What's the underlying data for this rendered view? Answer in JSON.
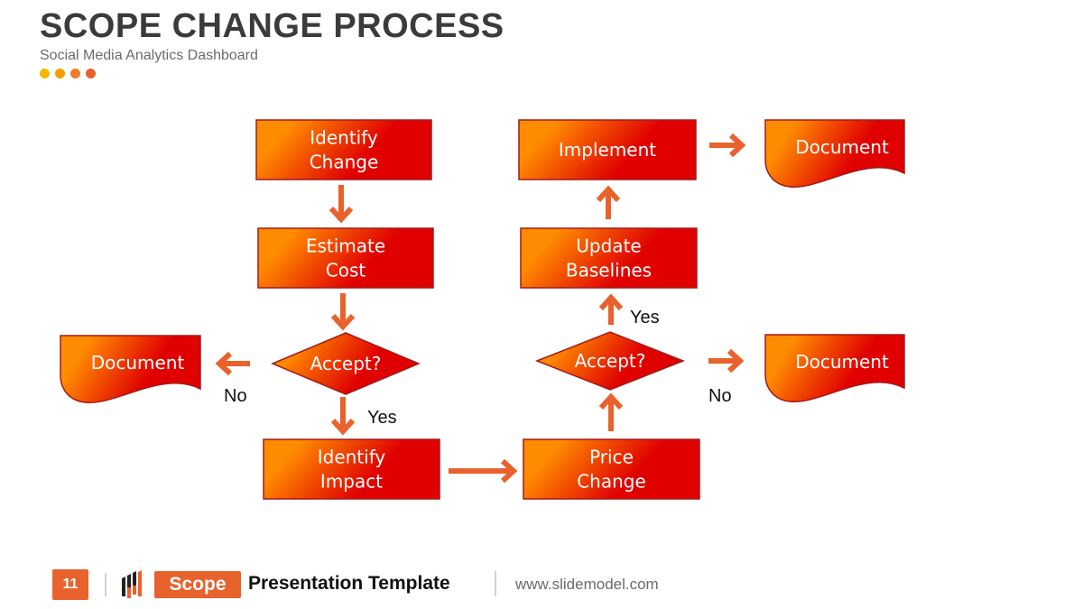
{
  "header": {
    "title": "SCOPE CHANGE PROCESS",
    "subtitle": "Social Media Analytics Dashboard",
    "dot_colors": [
      "#f5b800",
      "#f5a000",
      "#ee7c2c",
      "#e8622d"
    ]
  },
  "colors": {
    "gradient_start": "#ff8c00",
    "gradient_end": "#e00000",
    "node_border": "#a31a1a",
    "arrow": "#e8622d",
    "accent": "#e8622d"
  },
  "diagram": {
    "nodes": [
      {
        "id": "identify-change",
        "shape": "process",
        "lines": [
          "Identify",
          "Change"
        ]
      },
      {
        "id": "estimate-cost",
        "shape": "process",
        "lines": [
          "Estimate",
          "Cost"
        ]
      },
      {
        "id": "accept-1",
        "shape": "decision",
        "lines": [
          "Accept?"
        ]
      },
      {
        "id": "document-1",
        "shape": "document",
        "lines": [
          "Document"
        ]
      },
      {
        "id": "identify-impact",
        "shape": "process",
        "lines": [
          "Identify",
          "Impact"
        ]
      },
      {
        "id": "price-change",
        "shape": "process",
        "lines": [
          "Price",
          "Change"
        ]
      },
      {
        "id": "accept-2",
        "shape": "decision",
        "lines": [
          "Accept?"
        ]
      },
      {
        "id": "document-2",
        "shape": "document",
        "lines": [
          "Document"
        ]
      },
      {
        "id": "update-baselines",
        "shape": "process",
        "lines": [
          "Update",
          "Baselines"
        ]
      },
      {
        "id": "implement",
        "shape": "process",
        "lines": [
          "Implement"
        ]
      },
      {
        "id": "document-3",
        "shape": "document",
        "lines": [
          "Document"
        ]
      }
    ],
    "edges": [
      {
        "from": "identify-change",
        "to": "estimate-cost",
        "label": ""
      },
      {
        "from": "estimate-cost",
        "to": "accept-1",
        "label": ""
      },
      {
        "from": "accept-1",
        "to": "document-1",
        "label": "No"
      },
      {
        "from": "accept-1",
        "to": "identify-impact",
        "label": "Yes"
      },
      {
        "from": "identify-impact",
        "to": "price-change",
        "label": ""
      },
      {
        "from": "price-change",
        "to": "accept-2",
        "label": ""
      },
      {
        "from": "accept-2",
        "to": "document-2",
        "label": "No"
      },
      {
        "from": "accept-2",
        "to": "update-baselines",
        "label": "Yes"
      },
      {
        "from": "update-baselines",
        "to": "implement",
        "label": ""
      },
      {
        "from": "implement",
        "to": "document-3",
        "label": ""
      }
    ]
  },
  "footer": {
    "page_number": "11",
    "badge": "Scope",
    "template_label": "Presentation Template",
    "website": "www.slidemodel.com"
  }
}
